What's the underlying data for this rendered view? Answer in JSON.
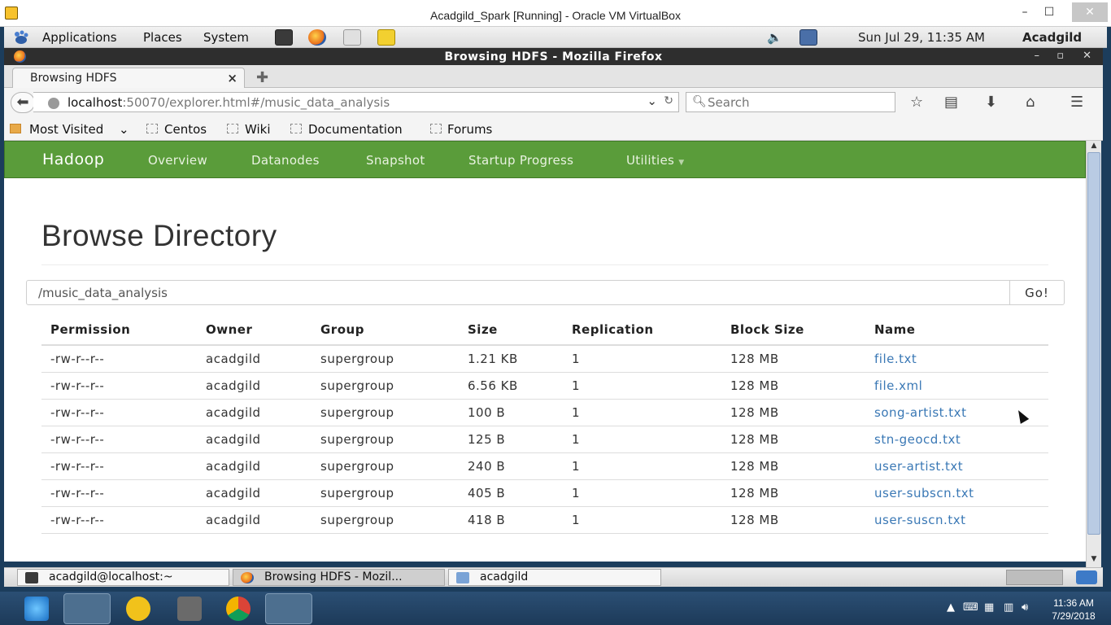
{
  "vbox": {
    "title": "Acadgild_Spark [Running] - Oracle VM VirtualBox",
    "minimize": "–",
    "maximize": "☐",
    "close": "✕"
  },
  "gnome_panel": {
    "menus": [
      "Applications",
      "Places",
      "System"
    ],
    "clock": "Sun Jul 29, 11:35 AM",
    "user": "Acadgild"
  },
  "firefox": {
    "window_title": "Browsing HDFS - Mozilla Firefox",
    "tab_label": "Browsing HDFS",
    "tab_close": "×",
    "new_tab": "✚",
    "url_host": "localhost",
    "url_rest": ":50070/explorer.html#/music_data_analysis",
    "search_placeholder": "Search",
    "bookmarks": [
      "Most Visited",
      "Centos",
      "Wiki",
      "Documentation",
      "Forums"
    ]
  },
  "hadoop": {
    "brand": "Hadoop",
    "nav": [
      "Overview",
      "Datanodes",
      "Snapshot",
      "Startup Progress",
      "Utilities"
    ],
    "page_title": "Browse Directory",
    "path_value": "/music_data_analysis",
    "go_label": "Go!",
    "columns": [
      "Permission",
      "Owner",
      "Group",
      "Size",
      "Replication",
      "Block Size",
      "Name"
    ],
    "rows": [
      [
        "-rw-r--r--",
        "acadgild",
        "supergroup",
        "1.21 KB",
        "1",
        "128 MB",
        "file.txt"
      ],
      [
        "-rw-r--r--",
        "acadgild",
        "supergroup",
        "6.56 KB",
        "1",
        "128 MB",
        "file.xml"
      ],
      [
        "-rw-r--r--",
        "acadgild",
        "supergroup",
        "100 B",
        "1",
        "128 MB",
        "song-artist.txt"
      ],
      [
        "-rw-r--r--",
        "acadgild",
        "supergroup",
        "125 B",
        "1",
        "128 MB",
        "stn-geocd.txt"
      ],
      [
        "-rw-r--r--",
        "acadgild",
        "supergroup",
        "240 B",
        "1",
        "128 MB",
        "user-artist.txt"
      ],
      [
        "-rw-r--r--",
        "acadgild",
        "supergroup",
        "405 B",
        "1",
        "128 MB",
        "user-subscn.txt"
      ],
      [
        "-rw-r--r--",
        "acadgild",
        "supergroup",
        "418 B",
        "1",
        "128 MB",
        "user-suscn.txt"
      ]
    ]
  },
  "taskbar_gnome": {
    "tasks": [
      "acadgild@localhost:~",
      "Browsing HDFS - Mozil...",
      "acadgild"
    ]
  },
  "windows_taskbar": {
    "time": "11:36 AM",
    "date": "7/29/2018"
  },
  "colors": {
    "hadoop_green": "#5a9c3a",
    "link_blue": "#3a78b5"
  }
}
